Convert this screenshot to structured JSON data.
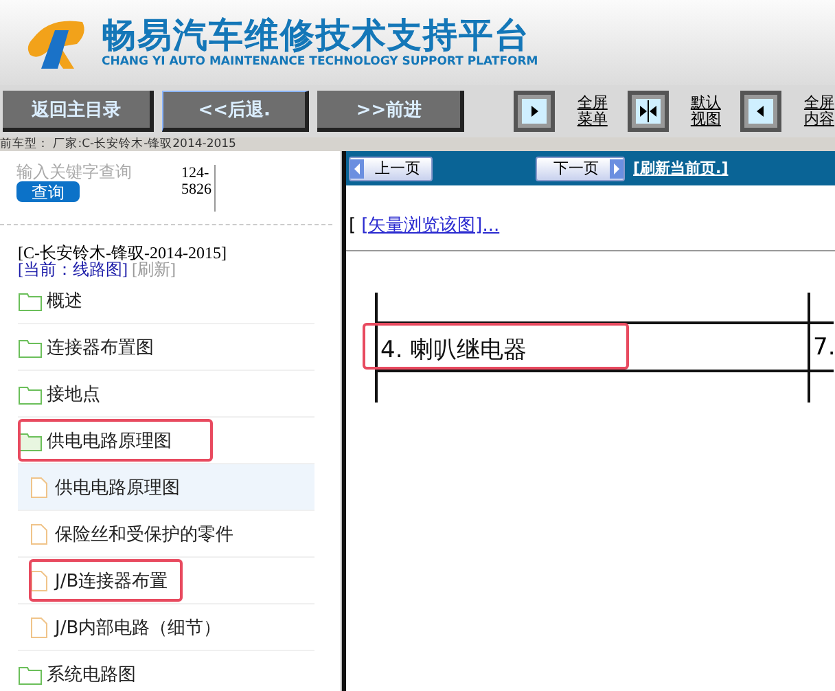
{
  "header": {
    "title": "畅易汽车维修技术支持平台",
    "subtitle": "CHANG YI AUTO MAINTENANCE TECHNOLOGY SUPPORT PLATFORM"
  },
  "toolbar": {
    "buttons": [
      {
        "label": "返回主目录",
        "selected": false
      },
      {
        "label": "<<后退.",
        "selected": true
      },
      {
        "label": ">>前进",
        "selected": false
      }
    ],
    "view_toggles": [
      {
        "kind": "right",
        "label": "全屏菜单"
      },
      {
        "kind": "both",
        "label": "默认视图"
      },
      {
        "kind": "left",
        "label": "全屏内容"
      }
    ]
  },
  "vehicle_line": "前车型：  厂家:C-长安铃木-锋驭2014-2015",
  "sidebar": {
    "search": {
      "placeholder": "输入关键字查询",
      "button": "查询",
      "code": "124-\n5826"
    },
    "vehicle": "[C-长安铃木-锋驭-2014-2015]",
    "current": "[当前：线路图]",
    "refresh": "[刷新]",
    "tree": [
      {
        "label": "概述",
        "kind": "folder",
        "expanded": false,
        "selected": false,
        "highlighted": false
      },
      {
        "label": "连接器布置图",
        "kind": "folder",
        "expanded": false,
        "selected": false,
        "highlighted": false
      },
      {
        "label": "接地点",
        "kind": "folder",
        "expanded": false,
        "selected": false,
        "highlighted": false
      },
      {
        "label": "供电电路原理图",
        "kind": "folder",
        "expanded": true,
        "selected": false,
        "highlighted": true,
        "children": [
          {
            "label": "供电电路原理图",
            "kind": "file",
            "selected": true,
            "highlighted": false
          },
          {
            "label": "保险丝和受保护的零件",
            "kind": "file",
            "selected": false,
            "highlighted": false
          },
          {
            "label": "J/B连接器布置",
            "kind": "file",
            "selected": false,
            "highlighted": true
          },
          {
            "label": "J/B内部电路（细节）",
            "kind": "file",
            "selected": false,
            "highlighted": false
          }
        ]
      },
      {
        "label": "系统电路图",
        "kind": "folder",
        "expanded": false,
        "selected": false,
        "highlighted": false
      }
    ]
  },
  "content": {
    "prev": "上一页",
    "next": "下一页",
    "refresh": "[刷新当前页.]",
    "vector_link": "[矢量浏览该图]...",
    "bracket": "[",
    "diagram": {
      "cell": "4. 喇叭继电器",
      "cell_highlighted": true,
      "next_cell": "7."
    }
  }
}
